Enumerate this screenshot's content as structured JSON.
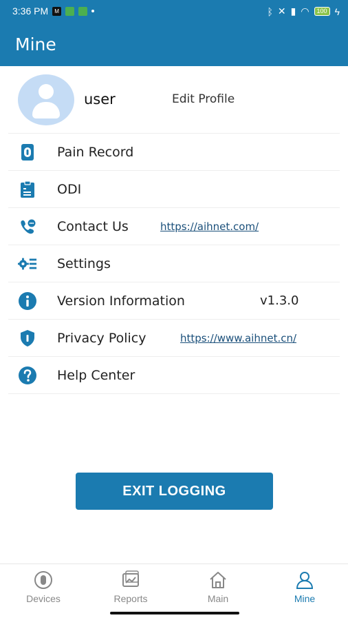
{
  "status_bar": {
    "time": "3:36 PM",
    "battery": "100"
  },
  "app_bar": {
    "title": "Mine"
  },
  "profile": {
    "username": "user",
    "edit_label": "Edit Profile"
  },
  "menu": {
    "items": [
      {
        "label": "Pain Record",
        "icon": "pain-record-icon"
      },
      {
        "label": "ODI",
        "icon": "clipboard-icon"
      },
      {
        "label": "Contact Us",
        "icon": "phone-chat-icon",
        "link": "https://aihnet.com/"
      },
      {
        "label": "Settings",
        "icon": "settings-gear-icon"
      },
      {
        "label": "Version Information",
        "icon": "info-icon",
        "value": "v1.3.0"
      },
      {
        "label": "Privacy Policy",
        "icon": "shield-icon",
        "link": "https://www.aihnet.cn/"
      },
      {
        "label": "Help Center",
        "icon": "help-icon"
      }
    ]
  },
  "exit_button": {
    "label": "EXIT LOGGING"
  },
  "bottom_nav": {
    "items": [
      {
        "label": "Devices",
        "icon": "devices-icon",
        "active": false
      },
      {
        "label": "Reports",
        "icon": "reports-icon",
        "active": false
      },
      {
        "label": "Main",
        "icon": "home-icon",
        "active": false
      },
      {
        "label": "Mine",
        "icon": "person-icon",
        "active": true
      }
    ]
  },
  "colors": {
    "primary": "#1b7bb0",
    "inactive": "#888888",
    "avatar_bg": "#c5dcf5"
  }
}
